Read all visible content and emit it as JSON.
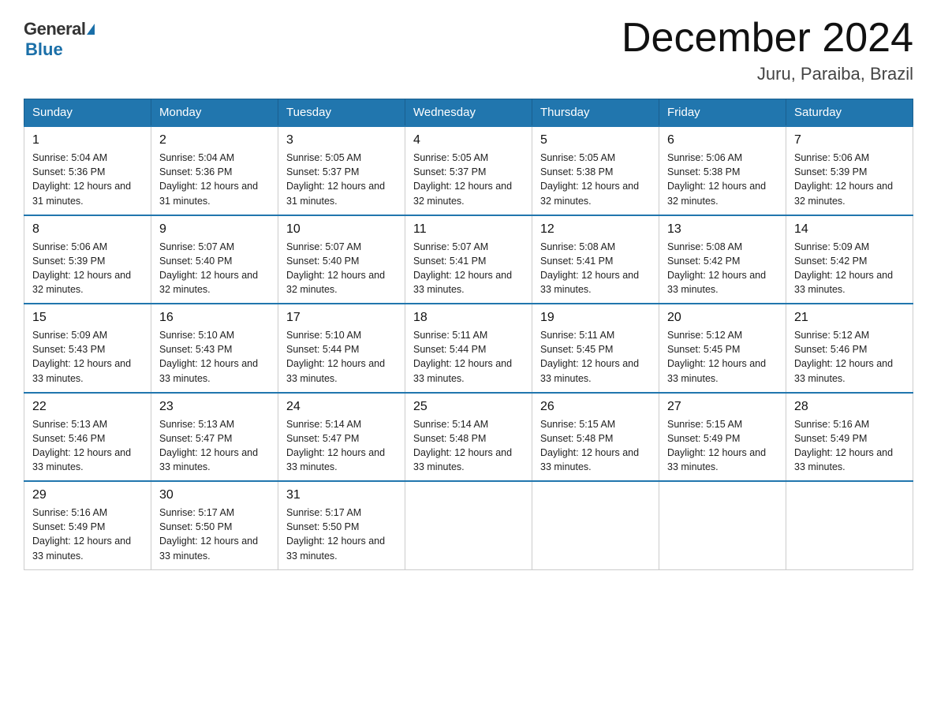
{
  "header": {
    "logo_general": "General",
    "logo_blue": "Blue",
    "title": "December 2024",
    "subtitle": "Juru, Paraiba, Brazil"
  },
  "days_of_week": [
    "Sunday",
    "Monday",
    "Tuesday",
    "Wednesday",
    "Thursday",
    "Friday",
    "Saturday"
  ],
  "weeks": [
    [
      {
        "day": "1",
        "sunrise": "Sunrise: 5:04 AM",
        "sunset": "Sunset: 5:36 PM",
        "daylight": "Daylight: 12 hours and 31 minutes."
      },
      {
        "day": "2",
        "sunrise": "Sunrise: 5:04 AM",
        "sunset": "Sunset: 5:36 PM",
        "daylight": "Daylight: 12 hours and 31 minutes."
      },
      {
        "day": "3",
        "sunrise": "Sunrise: 5:05 AM",
        "sunset": "Sunset: 5:37 PM",
        "daylight": "Daylight: 12 hours and 31 minutes."
      },
      {
        "day": "4",
        "sunrise": "Sunrise: 5:05 AM",
        "sunset": "Sunset: 5:37 PM",
        "daylight": "Daylight: 12 hours and 32 minutes."
      },
      {
        "day": "5",
        "sunrise": "Sunrise: 5:05 AM",
        "sunset": "Sunset: 5:38 PM",
        "daylight": "Daylight: 12 hours and 32 minutes."
      },
      {
        "day": "6",
        "sunrise": "Sunrise: 5:06 AM",
        "sunset": "Sunset: 5:38 PM",
        "daylight": "Daylight: 12 hours and 32 minutes."
      },
      {
        "day": "7",
        "sunrise": "Sunrise: 5:06 AM",
        "sunset": "Sunset: 5:39 PM",
        "daylight": "Daylight: 12 hours and 32 minutes."
      }
    ],
    [
      {
        "day": "8",
        "sunrise": "Sunrise: 5:06 AM",
        "sunset": "Sunset: 5:39 PM",
        "daylight": "Daylight: 12 hours and 32 minutes."
      },
      {
        "day": "9",
        "sunrise": "Sunrise: 5:07 AM",
        "sunset": "Sunset: 5:40 PM",
        "daylight": "Daylight: 12 hours and 32 minutes."
      },
      {
        "day": "10",
        "sunrise": "Sunrise: 5:07 AM",
        "sunset": "Sunset: 5:40 PM",
        "daylight": "Daylight: 12 hours and 32 minutes."
      },
      {
        "day": "11",
        "sunrise": "Sunrise: 5:07 AM",
        "sunset": "Sunset: 5:41 PM",
        "daylight": "Daylight: 12 hours and 33 minutes."
      },
      {
        "day": "12",
        "sunrise": "Sunrise: 5:08 AM",
        "sunset": "Sunset: 5:41 PM",
        "daylight": "Daylight: 12 hours and 33 minutes."
      },
      {
        "day": "13",
        "sunrise": "Sunrise: 5:08 AM",
        "sunset": "Sunset: 5:42 PM",
        "daylight": "Daylight: 12 hours and 33 minutes."
      },
      {
        "day": "14",
        "sunrise": "Sunrise: 5:09 AM",
        "sunset": "Sunset: 5:42 PM",
        "daylight": "Daylight: 12 hours and 33 minutes."
      }
    ],
    [
      {
        "day": "15",
        "sunrise": "Sunrise: 5:09 AM",
        "sunset": "Sunset: 5:43 PM",
        "daylight": "Daylight: 12 hours and 33 minutes."
      },
      {
        "day": "16",
        "sunrise": "Sunrise: 5:10 AM",
        "sunset": "Sunset: 5:43 PM",
        "daylight": "Daylight: 12 hours and 33 minutes."
      },
      {
        "day": "17",
        "sunrise": "Sunrise: 5:10 AM",
        "sunset": "Sunset: 5:44 PM",
        "daylight": "Daylight: 12 hours and 33 minutes."
      },
      {
        "day": "18",
        "sunrise": "Sunrise: 5:11 AM",
        "sunset": "Sunset: 5:44 PM",
        "daylight": "Daylight: 12 hours and 33 minutes."
      },
      {
        "day": "19",
        "sunrise": "Sunrise: 5:11 AM",
        "sunset": "Sunset: 5:45 PM",
        "daylight": "Daylight: 12 hours and 33 minutes."
      },
      {
        "day": "20",
        "sunrise": "Sunrise: 5:12 AM",
        "sunset": "Sunset: 5:45 PM",
        "daylight": "Daylight: 12 hours and 33 minutes."
      },
      {
        "day": "21",
        "sunrise": "Sunrise: 5:12 AM",
        "sunset": "Sunset: 5:46 PM",
        "daylight": "Daylight: 12 hours and 33 minutes."
      }
    ],
    [
      {
        "day": "22",
        "sunrise": "Sunrise: 5:13 AM",
        "sunset": "Sunset: 5:46 PM",
        "daylight": "Daylight: 12 hours and 33 minutes."
      },
      {
        "day": "23",
        "sunrise": "Sunrise: 5:13 AM",
        "sunset": "Sunset: 5:47 PM",
        "daylight": "Daylight: 12 hours and 33 minutes."
      },
      {
        "day": "24",
        "sunrise": "Sunrise: 5:14 AM",
        "sunset": "Sunset: 5:47 PM",
        "daylight": "Daylight: 12 hours and 33 minutes."
      },
      {
        "day": "25",
        "sunrise": "Sunrise: 5:14 AM",
        "sunset": "Sunset: 5:48 PM",
        "daylight": "Daylight: 12 hours and 33 minutes."
      },
      {
        "day": "26",
        "sunrise": "Sunrise: 5:15 AM",
        "sunset": "Sunset: 5:48 PM",
        "daylight": "Daylight: 12 hours and 33 minutes."
      },
      {
        "day": "27",
        "sunrise": "Sunrise: 5:15 AM",
        "sunset": "Sunset: 5:49 PM",
        "daylight": "Daylight: 12 hours and 33 minutes."
      },
      {
        "day": "28",
        "sunrise": "Sunrise: 5:16 AM",
        "sunset": "Sunset: 5:49 PM",
        "daylight": "Daylight: 12 hours and 33 minutes."
      }
    ],
    [
      {
        "day": "29",
        "sunrise": "Sunrise: 5:16 AM",
        "sunset": "Sunset: 5:49 PM",
        "daylight": "Daylight: 12 hours and 33 minutes."
      },
      {
        "day": "30",
        "sunrise": "Sunrise: 5:17 AM",
        "sunset": "Sunset: 5:50 PM",
        "daylight": "Daylight: 12 hours and 33 minutes."
      },
      {
        "day": "31",
        "sunrise": "Sunrise: 5:17 AM",
        "sunset": "Sunset: 5:50 PM",
        "daylight": "Daylight: 12 hours and 33 minutes."
      },
      null,
      null,
      null,
      null
    ]
  ]
}
